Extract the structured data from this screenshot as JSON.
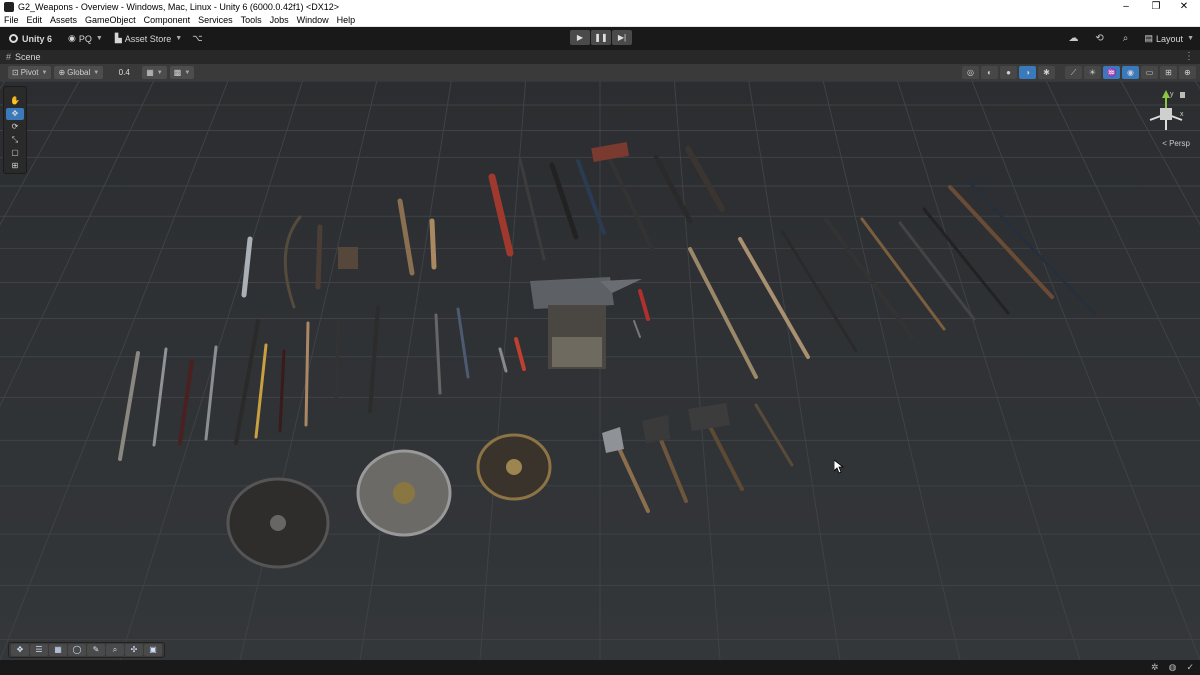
{
  "window": {
    "title": "G2_Weapons - Overview - Windows, Mac, Linux - Unity 6 (6000.0.42f1) <DX12>",
    "controls": {
      "minimize": "–",
      "maximize": "❐",
      "close": "✕"
    }
  },
  "menu": [
    "File",
    "Edit",
    "Assets",
    "GameObject",
    "Component",
    "Services",
    "Tools",
    "Jobs",
    "Window",
    "Help"
  ],
  "toolbar": {
    "unity_label": "Unity 6",
    "account_label": "PQ",
    "asset_store_label": "Asset Store",
    "play_icons": [
      "▶",
      "❚❚",
      "▶|"
    ],
    "layout_label": "Layout"
  },
  "scene": {
    "tab_label": "Scene",
    "pivot_label": "Pivot",
    "global_label": "Global",
    "snap_value": "0.4",
    "persp_label": "< Persp"
  },
  "gizmo": {
    "y_label": "y",
    "x_label": "x"
  },
  "colors": {
    "accent": "#3a79bb",
    "viewport_bg": "#2f3134",
    "grid": "#3d4044"
  }
}
